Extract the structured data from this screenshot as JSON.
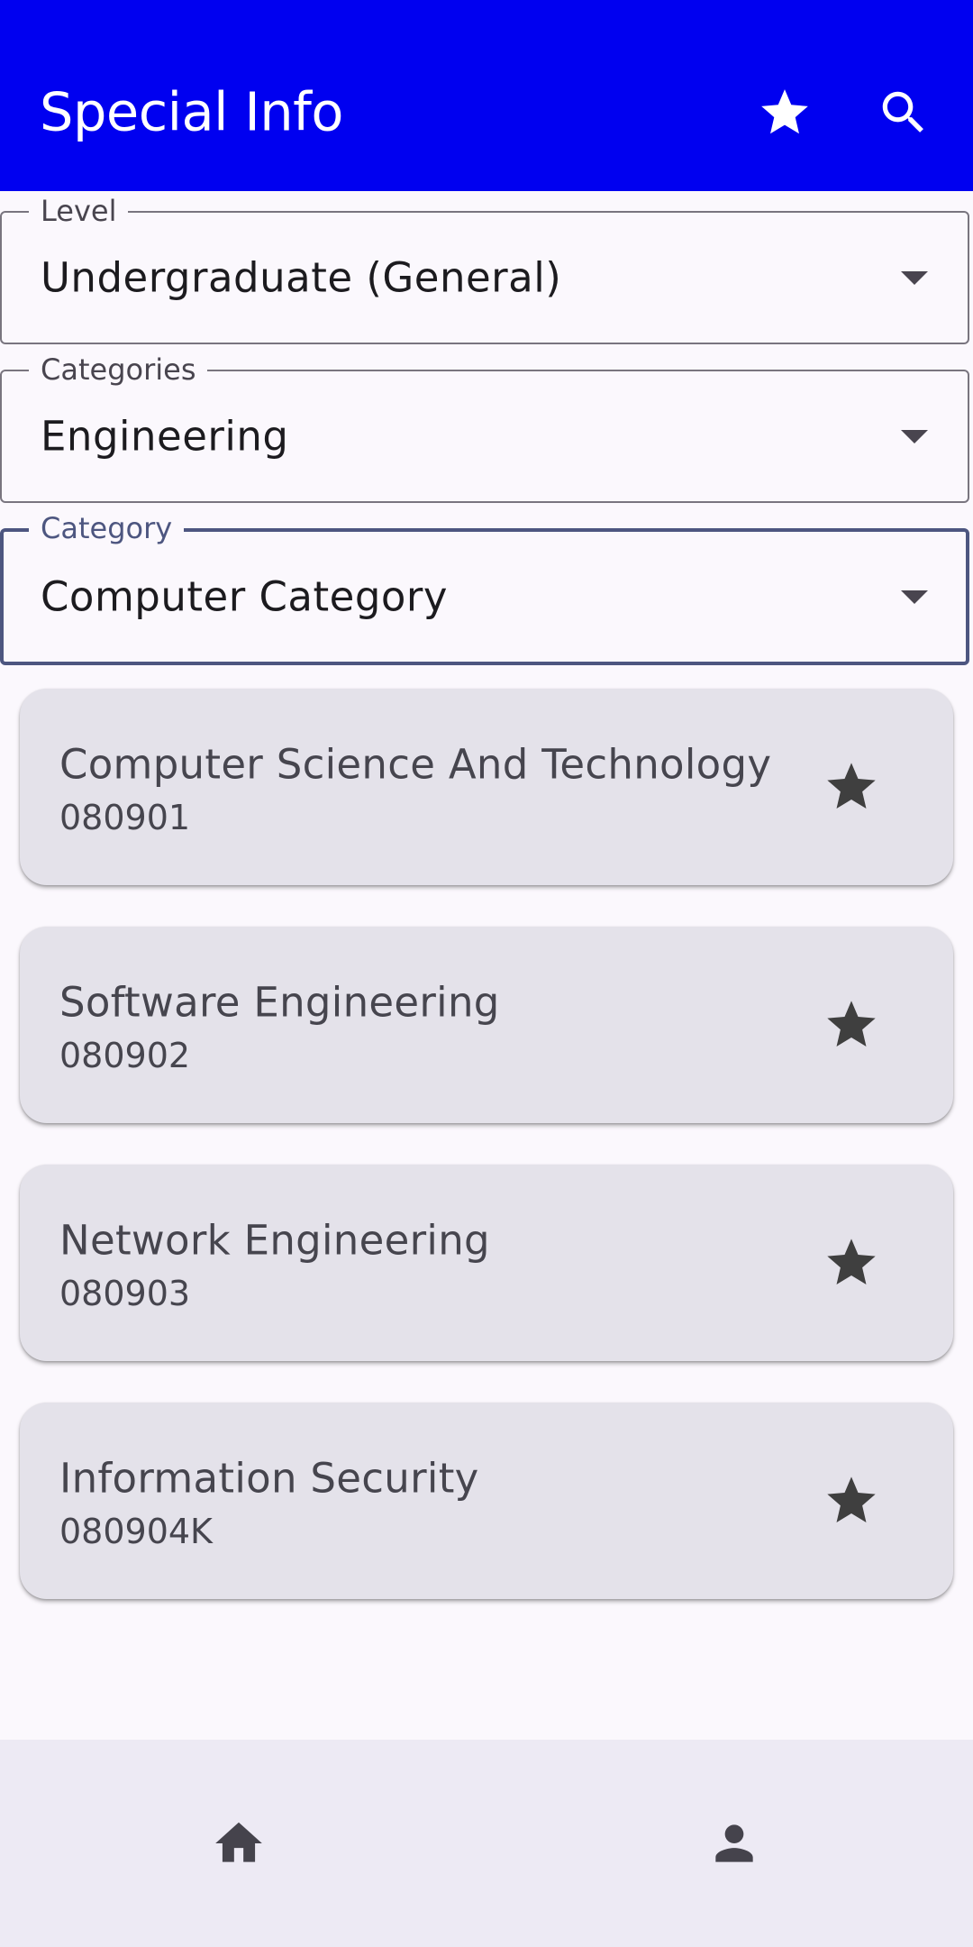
{
  "app_bar": {
    "title": "Special Info",
    "actions": [
      {
        "icon": "star-icon"
      },
      {
        "icon": "search-icon"
      }
    ],
    "background_color": "#0000f0"
  },
  "filters": {
    "level": {
      "label": "Level",
      "value": "Undergraduate (General)"
    },
    "categories": {
      "label": "Categories",
      "value": "Engineering"
    },
    "category": {
      "label": "Category",
      "value": "Computer Category"
    }
  },
  "majors": [
    {
      "name": "Computer Science And Technology",
      "code": "080901"
    },
    {
      "name": "Software Engineering",
      "code": "080902"
    },
    {
      "name": "Network Engineering",
      "code": "080903"
    },
    {
      "name": "Information Security",
      "code": "080904K"
    }
  ],
  "bottom_nav": {
    "items": [
      {
        "icon": "home-icon"
      },
      {
        "icon": "person-icon"
      }
    ]
  },
  "colors": {
    "primary": "#0000f0",
    "background": "#fbf8fd",
    "card": "#e4e2ea",
    "focused_outline": "#4d5680",
    "nav_background": "#edeaf4"
  }
}
